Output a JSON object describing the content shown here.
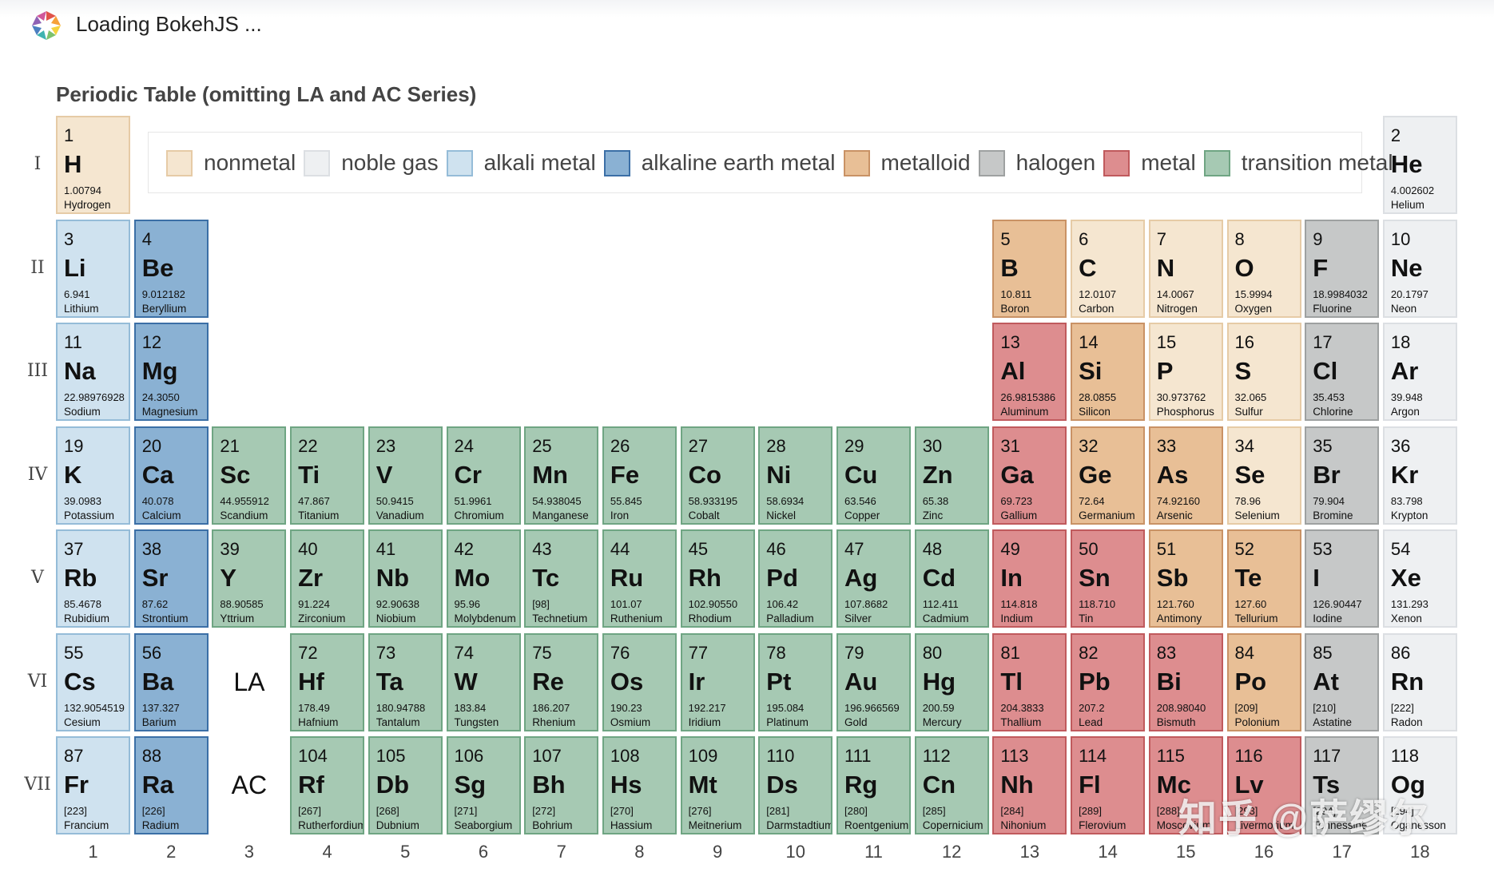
{
  "loading": {
    "text": "Loading BokehJS ..."
  },
  "plot": {
    "title": "Periodic Table (omitting LA and AC Series)"
  },
  "colors": {
    "nonmetal": {
      "fill": "#f5e6d0",
      "border": "#e6cba6"
    },
    "noble gas": {
      "fill": "#eef0f2",
      "border": "#dcdfe3"
    },
    "alkali metal": {
      "fill": "#cfe2ef",
      "border": "#95bcd8"
    },
    "alkaline earth metal": {
      "fill": "#8ab1d3",
      "border": "#3b6fa6"
    },
    "metalloid": {
      "fill": "#e8bf96",
      "border": "#c99265"
    },
    "halogen": {
      "fill": "#c6c8c8",
      "border": "#9ea1a1"
    },
    "metal": {
      "fill": "#dd8d8f",
      "border": "#c05a5d"
    },
    "transition metal": {
      "fill": "#a6c9b3",
      "border": "#6fa583"
    }
  },
  "legend": [
    {
      "key": "nonmetal",
      "label": "nonmetal"
    },
    {
      "key": "noble gas",
      "label": "noble gas"
    },
    {
      "key": "alkali metal",
      "label": "alkali metal"
    },
    {
      "key": "alkaline earth metal",
      "label": "alkaline earth metal"
    },
    {
      "key": "metalloid",
      "label": "metalloid"
    },
    {
      "key": "halogen",
      "label": "halogen"
    },
    {
      "key": "metal",
      "label": "metal"
    },
    {
      "key": "transition metal",
      "label": "transition metal"
    }
  ],
  "periods": [
    "I",
    "II",
    "III",
    "IV",
    "V",
    "VI",
    "VII"
  ],
  "groups": [
    "1",
    "2",
    "3",
    "4",
    "5",
    "6",
    "7",
    "8",
    "9",
    "10",
    "11",
    "12",
    "13",
    "14",
    "15",
    "16",
    "17",
    "18"
  ],
  "series_labels": [
    {
      "period": 6,
      "group": 3,
      "text": "LA"
    },
    {
      "period": 7,
      "group": 3,
      "text": "AC"
    }
  ],
  "elements": [
    {
      "n": "1",
      "s": "H",
      "m": "1.00794",
      "name": "Hydrogen",
      "g": 1,
      "p": 1,
      "type": "nonmetal"
    },
    {
      "n": "2",
      "s": "He",
      "m": "4.002602",
      "name": "Helium",
      "g": 18,
      "p": 1,
      "type": "noble gas"
    },
    {
      "n": "3",
      "s": "Li",
      "m": "6.941",
      "name": "Lithium",
      "g": 1,
      "p": 2,
      "type": "alkali metal"
    },
    {
      "n": "4",
      "s": "Be",
      "m": "9.012182",
      "name": "Beryllium",
      "g": 2,
      "p": 2,
      "type": "alkaline earth metal"
    },
    {
      "n": "5",
      "s": "B",
      "m": "10.811",
      "name": "Boron",
      "g": 13,
      "p": 2,
      "type": "metalloid"
    },
    {
      "n": "6",
      "s": "C",
      "m": "12.0107",
      "name": "Carbon",
      "g": 14,
      "p": 2,
      "type": "nonmetal"
    },
    {
      "n": "7",
      "s": "N",
      "m": "14.0067",
      "name": "Nitrogen",
      "g": 15,
      "p": 2,
      "type": "nonmetal"
    },
    {
      "n": "8",
      "s": "O",
      "m": "15.9994",
      "name": "Oxygen",
      "g": 16,
      "p": 2,
      "type": "nonmetal"
    },
    {
      "n": "9",
      "s": "F",
      "m": "18.9984032",
      "name": "Fluorine",
      "g": 17,
      "p": 2,
      "type": "halogen"
    },
    {
      "n": "10",
      "s": "Ne",
      "m": "20.1797",
      "name": "Neon",
      "g": 18,
      "p": 2,
      "type": "noble gas"
    },
    {
      "n": "11",
      "s": "Na",
      "m": "22.98976928",
      "name": "Sodium",
      "g": 1,
      "p": 3,
      "type": "alkali metal"
    },
    {
      "n": "12",
      "s": "Mg",
      "m": "24.3050",
      "name": "Magnesium",
      "g": 2,
      "p": 3,
      "type": "alkaline earth metal"
    },
    {
      "n": "13",
      "s": "Al",
      "m": "26.9815386",
      "name": "Aluminum",
      "g": 13,
      "p": 3,
      "type": "metal"
    },
    {
      "n": "14",
      "s": "Si",
      "m": "28.0855",
      "name": "Silicon",
      "g": 14,
      "p": 3,
      "type": "metalloid"
    },
    {
      "n": "15",
      "s": "P",
      "m": "30.973762",
      "name": "Phosphorus",
      "g": 15,
      "p": 3,
      "type": "nonmetal"
    },
    {
      "n": "16",
      "s": "S",
      "m": "32.065",
      "name": "Sulfur",
      "g": 16,
      "p": 3,
      "type": "nonmetal"
    },
    {
      "n": "17",
      "s": "Cl",
      "m": "35.453",
      "name": "Chlorine",
      "g": 17,
      "p": 3,
      "type": "halogen"
    },
    {
      "n": "18",
      "s": "Ar",
      "m": "39.948",
      "name": "Argon",
      "g": 18,
      "p": 3,
      "type": "noble gas"
    },
    {
      "n": "19",
      "s": "K",
      "m": "39.0983",
      "name": "Potassium",
      "g": 1,
      "p": 4,
      "type": "alkali metal"
    },
    {
      "n": "20",
      "s": "Ca",
      "m": "40.078",
      "name": "Calcium",
      "g": 2,
      "p": 4,
      "type": "alkaline earth metal"
    },
    {
      "n": "21",
      "s": "Sc",
      "m": "44.955912",
      "name": "Scandium",
      "g": 3,
      "p": 4,
      "type": "transition metal"
    },
    {
      "n": "22",
      "s": "Ti",
      "m": "47.867",
      "name": "Titanium",
      "g": 4,
      "p": 4,
      "type": "transition metal"
    },
    {
      "n": "23",
      "s": "V",
      "m": "50.9415",
      "name": "Vanadium",
      "g": 5,
      "p": 4,
      "type": "transition metal"
    },
    {
      "n": "24",
      "s": "Cr",
      "m": "51.9961",
      "name": "Chromium",
      "g": 6,
      "p": 4,
      "type": "transition metal"
    },
    {
      "n": "25",
      "s": "Mn",
      "m": "54.938045",
      "name": "Manganese",
      "g": 7,
      "p": 4,
      "type": "transition metal"
    },
    {
      "n": "26",
      "s": "Fe",
      "m": "55.845",
      "name": "Iron",
      "g": 8,
      "p": 4,
      "type": "transition metal"
    },
    {
      "n": "27",
      "s": "Co",
      "m": "58.933195",
      "name": "Cobalt",
      "g": 9,
      "p": 4,
      "type": "transition metal"
    },
    {
      "n": "28",
      "s": "Ni",
      "m": "58.6934",
      "name": "Nickel",
      "g": 10,
      "p": 4,
      "type": "transition metal"
    },
    {
      "n": "29",
      "s": "Cu",
      "m": "63.546",
      "name": "Copper",
      "g": 11,
      "p": 4,
      "type": "transition metal"
    },
    {
      "n": "30",
      "s": "Zn",
      "m": "65.38",
      "name": "Zinc",
      "g": 12,
      "p": 4,
      "type": "transition metal"
    },
    {
      "n": "31",
      "s": "Ga",
      "m": "69.723",
      "name": "Gallium",
      "g": 13,
      "p": 4,
      "type": "metal"
    },
    {
      "n": "32",
      "s": "Ge",
      "m": "72.64",
      "name": "Germanium",
      "g": 14,
      "p": 4,
      "type": "metalloid"
    },
    {
      "n": "33",
      "s": "As",
      "m": "74.92160",
      "name": "Arsenic",
      "g": 15,
      "p": 4,
      "type": "metalloid"
    },
    {
      "n": "34",
      "s": "Se",
      "m": "78.96",
      "name": "Selenium",
      "g": 16,
      "p": 4,
      "type": "nonmetal"
    },
    {
      "n": "35",
      "s": "Br",
      "m": "79.904",
      "name": "Bromine",
      "g": 17,
      "p": 4,
      "type": "halogen"
    },
    {
      "n": "36",
      "s": "Kr",
      "m": "83.798",
      "name": "Krypton",
      "g": 18,
      "p": 4,
      "type": "noble gas"
    },
    {
      "n": "37",
      "s": "Rb",
      "m": "85.4678",
      "name": "Rubidium",
      "g": 1,
      "p": 5,
      "type": "alkali metal"
    },
    {
      "n": "38",
      "s": "Sr",
      "m": "87.62",
      "name": "Strontium",
      "g": 2,
      "p": 5,
      "type": "alkaline earth metal"
    },
    {
      "n": "39",
      "s": "Y",
      "m": "88.90585",
      "name": "Yttrium",
      "g": 3,
      "p": 5,
      "type": "transition metal"
    },
    {
      "n": "40",
      "s": "Zr",
      "m": "91.224",
      "name": "Zirconium",
      "g": 4,
      "p": 5,
      "type": "transition metal"
    },
    {
      "n": "41",
      "s": "Nb",
      "m": "92.90638",
      "name": "Niobium",
      "g": 5,
      "p": 5,
      "type": "transition metal"
    },
    {
      "n": "42",
      "s": "Mo",
      "m": "95.96",
      "name": "Molybdenum",
      "g": 6,
      "p": 5,
      "type": "transition metal"
    },
    {
      "n": "43",
      "s": "Tc",
      "m": "[98]",
      "name": "Technetium",
      "g": 7,
      "p": 5,
      "type": "transition metal"
    },
    {
      "n": "44",
      "s": "Ru",
      "m": "101.07",
      "name": "Ruthenium",
      "g": 8,
      "p": 5,
      "type": "transition metal"
    },
    {
      "n": "45",
      "s": "Rh",
      "m": "102.90550",
      "name": "Rhodium",
      "g": 9,
      "p": 5,
      "type": "transition metal"
    },
    {
      "n": "46",
      "s": "Pd",
      "m": "106.42",
      "name": "Palladium",
      "g": 10,
      "p": 5,
      "type": "transition metal"
    },
    {
      "n": "47",
      "s": "Ag",
      "m": "107.8682",
      "name": "Silver",
      "g": 11,
      "p": 5,
      "type": "transition metal"
    },
    {
      "n": "48",
      "s": "Cd",
      "m": "112.411",
      "name": "Cadmium",
      "g": 12,
      "p": 5,
      "type": "transition metal"
    },
    {
      "n": "49",
      "s": "In",
      "m": "114.818",
      "name": "Indium",
      "g": 13,
      "p": 5,
      "type": "metal"
    },
    {
      "n": "50",
      "s": "Sn",
      "m": "118.710",
      "name": "Tin",
      "g": 14,
      "p": 5,
      "type": "metal"
    },
    {
      "n": "51",
      "s": "Sb",
      "m": "121.760",
      "name": "Antimony",
      "g": 15,
      "p": 5,
      "type": "metalloid"
    },
    {
      "n": "52",
      "s": "Te",
      "m": "127.60",
      "name": "Tellurium",
      "g": 16,
      "p": 5,
      "type": "metalloid"
    },
    {
      "n": "53",
      "s": "I",
      "m": "126.90447",
      "name": "Iodine",
      "g": 17,
      "p": 5,
      "type": "halogen"
    },
    {
      "n": "54",
      "s": "Xe",
      "m": "131.293",
      "name": "Xenon",
      "g": 18,
      "p": 5,
      "type": "noble gas"
    },
    {
      "n": "55",
      "s": "Cs",
      "m": "132.9054519",
      "name": "Cesium",
      "g": 1,
      "p": 6,
      "type": "alkali metal"
    },
    {
      "n": "56",
      "s": "Ba",
      "m": "137.327",
      "name": "Barium",
      "g": 2,
      "p": 6,
      "type": "alkaline earth metal"
    },
    {
      "n": "72",
      "s": "Hf",
      "m": "178.49",
      "name": "Hafnium",
      "g": 4,
      "p": 6,
      "type": "transition metal"
    },
    {
      "n": "73",
      "s": "Ta",
      "m": "180.94788",
      "name": "Tantalum",
      "g": 5,
      "p": 6,
      "type": "transition metal"
    },
    {
      "n": "74",
      "s": "W",
      "m": "183.84",
      "name": "Tungsten",
      "g": 6,
      "p": 6,
      "type": "transition metal"
    },
    {
      "n": "75",
      "s": "Re",
      "m": "186.207",
      "name": "Rhenium",
      "g": 7,
      "p": 6,
      "type": "transition metal"
    },
    {
      "n": "76",
      "s": "Os",
      "m": "190.23",
      "name": "Osmium",
      "g": 8,
      "p": 6,
      "type": "transition metal"
    },
    {
      "n": "77",
      "s": "Ir",
      "m": "192.217",
      "name": "Iridium",
      "g": 9,
      "p": 6,
      "type": "transition metal"
    },
    {
      "n": "78",
      "s": "Pt",
      "m": "195.084",
      "name": "Platinum",
      "g": 10,
      "p": 6,
      "type": "transition metal"
    },
    {
      "n": "79",
      "s": "Au",
      "m": "196.966569",
      "name": "Gold",
      "g": 11,
      "p": 6,
      "type": "transition metal"
    },
    {
      "n": "80",
      "s": "Hg",
      "m": "200.59",
      "name": "Mercury",
      "g": 12,
      "p": 6,
      "type": "transition metal"
    },
    {
      "n": "81",
      "s": "Tl",
      "m": "204.3833",
      "name": "Thallium",
      "g": 13,
      "p": 6,
      "type": "metal"
    },
    {
      "n": "82",
      "s": "Pb",
      "m": "207.2",
      "name": "Lead",
      "g": 14,
      "p": 6,
      "type": "metal"
    },
    {
      "n": "83",
      "s": "Bi",
      "m": "208.98040",
      "name": "Bismuth",
      "g": 15,
      "p": 6,
      "type": "metal"
    },
    {
      "n": "84",
      "s": "Po",
      "m": "[209]",
      "name": "Polonium",
      "g": 16,
      "p": 6,
      "type": "metalloid"
    },
    {
      "n": "85",
      "s": "At",
      "m": "[210]",
      "name": "Astatine",
      "g": 17,
      "p": 6,
      "type": "halogen"
    },
    {
      "n": "86",
      "s": "Rn",
      "m": "[222]",
      "name": "Radon",
      "g": 18,
      "p": 6,
      "type": "noble gas"
    },
    {
      "n": "87",
      "s": "Fr",
      "m": "[223]",
      "name": "Francium",
      "g": 1,
      "p": 7,
      "type": "alkali metal"
    },
    {
      "n": "88",
      "s": "Ra",
      "m": "[226]",
      "name": "Radium",
      "g": 2,
      "p": 7,
      "type": "alkaline earth metal"
    },
    {
      "n": "104",
      "s": "Rf",
      "m": "[267]",
      "name": "Rutherfordium",
      "g": 4,
      "p": 7,
      "type": "transition metal"
    },
    {
      "n": "105",
      "s": "Db",
      "m": "[268]",
      "name": "Dubnium",
      "g": 5,
      "p": 7,
      "type": "transition metal"
    },
    {
      "n": "106",
      "s": "Sg",
      "m": "[271]",
      "name": "Seaborgium",
      "g": 6,
      "p": 7,
      "type": "transition metal"
    },
    {
      "n": "107",
      "s": "Bh",
      "m": "[272]",
      "name": "Bohrium",
      "g": 7,
      "p": 7,
      "type": "transition metal"
    },
    {
      "n": "108",
      "s": "Hs",
      "m": "[270]",
      "name": "Hassium",
      "g": 8,
      "p": 7,
      "type": "transition metal"
    },
    {
      "n": "109",
      "s": "Mt",
      "m": "[276]",
      "name": "Meitnerium",
      "g": 9,
      "p": 7,
      "type": "transition metal"
    },
    {
      "n": "110",
      "s": "Ds",
      "m": "[281]",
      "name": "Darmstadtium",
      "g": 10,
      "p": 7,
      "type": "transition metal"
    },
    {
      "n": "111",
      "s": "Rg",
      "m": "[280]",
      "name": "Roentgenium",
      "g": 11,
      "p": 7,
      "type": "transition metal"
    },
    {
      "n": "112",
      "s": "Cn",
      "m": "[285]",
      "name": "Copernicium",
      "g": 12,
      "p": 7,
      "type": "transition metal"
    },
    {
      "n": "113",
      "s": "Nh",
      "m": "[284]",
      "name": "Nihonium",
      "g": 13,
      "p": 7,
      "type": "metal"
    },
    {
      "n": "114",
      "s": "Fl",
      "m": "[289]",
      "name": "Flerovium",
      "g": 14,
      "p": 7,
      "type": "metal"
    },
    {
      "n": "115",
      "s": "Mc",
      "m": "[288]",
      "name": "Moscovium",
      "g": 15,
      "p": 7,
      "type": "metal"
    },
    {
      "n": "116",
      "s": "Lv",
      "m": "[293]",
      "name": "Livermorium",
      "g": 16,
      "p": 7,
      "type": "metal"
    },
    {
      "n": "117",
      "s": "Ts",
      "m": "[294]",
      "name": "Tennessine",
      "g": 17,
      "p": 7,
      "type": "halogen"
    },
    {
      "n": "118",
      "s": "Og",
      "m": "[294]",
      "name": "Oganesson",
      "g": 18,
      "p": 7,
      "type": "noble gas"
    }
  ],
  "watermark": {
    "text": "知乎 @萨缪尔"
  }
}
